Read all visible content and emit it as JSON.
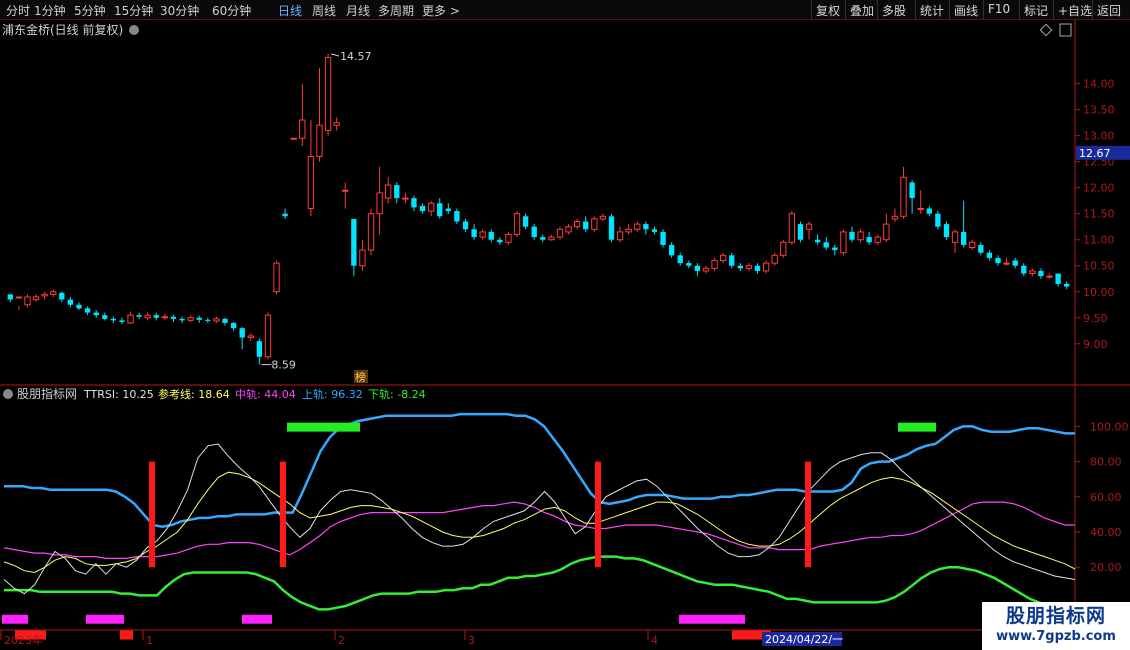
{
  "toolbar": {
    "periods": [
      {
        "label": "分时",
        "active": false
      },
      {
        "label": "1分钟",
        "active": false
      },
      {
        "label": "5分钟",
        "active": false
      },
      {
        "label": "15分钟",
        "active": false
      },
      {
        "label": "30分钟",
        "active": false
      },
      {
        "label": "60分钟",
        "active": false
      },
      {
        "label": "日线",
        "active": true
      },
      {
        "label": "周线",
        "active": false
      },
      {
        "label": "月线",
        "active": false
      },
      {
        "label": "多周期",
        "active": false
      },
      {
        "label": "更多 >",
        "active": false
      }
    ],
    "right_buttons": [
      "复权",
      "叠加",
      "多股",
      "统计",
      "画线",
      "F10",
      "标记",
      "+自选",
      "返回"
    ]
  },
  "price_panel": {
    "title": "浦东金桥(日线 前复权)",
    "high_label": "14.57",
    "low_label": "8.59",
    "current_price": "12.67",
    "tag": "榜",
    "y_labels": [
      "14.00",
      "13.50",
      "13.00",
      "12.50",
      "12.00",
      "11.50",
      "11.00",
      "10.50",
      "10.00",
      "9.50",
      "9.00"
    ]
  },
  "indicator_panel": {
    "name": "股朋指标网",
    "items": [
      {
        "label": "TTRSI: 10.25",
        "color": "#e0e0e0"
      },
      {
        "label": "参考线: 18.64",
        "color": "#ffff66"
      },
      {
        "label": "中轨: 44.04",
        "color": "#ff44ff"
      },
      {
        "label": "上轨: 96.32",
        "color": "#33aaff"
      },
      {
        "label": "下轨: -8.24",
        "color": "#33ee33"
      }
    ],
    "y_labels": [
      "100.00",
      "80.00",
      "60.00",
      "40.00",
      "20.00"
    ]
  },
  "time_axis": {
    "labels": [
      "2023年",
      "1",
      "2",
      "3",
      "4"
    ],
    "cursor_label": "2024/04/22/一"
  },
  "watermark": {
    "title": "股朋指标网",
    "url": "www.7gpzb.com"
  },
  "colors": {
    "up": "#ff3b3b",
    "down": "#00e5ff",
    "axis": "#b01818",
    "upper_band": "#33aaff",
    "middle_band": "#ff44ff",
    "lower_band": "#33ee33",
    "ttrsi": "#e0e0e0",
    "reference": "#ffff66"
  },
  "chart_data": {
    "type": "candlestick",
    "ohlc": [
      [
        9.95,
        9.85,
        9.9,
        9.8
      ],
      [
        9.88,
        9.9,
        9.72,
        9.65
      ],
      [
        9.75,
        9.9,
        9.95,
        9.7
      ],
      [
        9.85,
        9.9,
        9.95,
        9.8
      ],
      [
        9.92,
        9.95,
        10.0,
        9.85
      ],
      [
        9.95,
        10.0,
        10.05,
        9.9
      ],
      [
        9.98,
        9.85,
        10.0,
        9.8
      ],
      [
        9.85,
        9.75,
        9.9,
        9.7
      ],
      [
        9.75,
        9.68,
        9.8,
        9.65
      ],
      [
        9.68,
        9.6,
        9.72,
        9.55
      ],
      [
        9.6,
        9.55,
        9.65,
        9.5
      ],
      [
        9.55,
        9.48,
        9.6,
        9.45
      ],
      [
        9.48,
        9.45,
        9.52,
        9.4
      ],
      [
        9.45,
        9.42,
        9.5,
        9.38
      ],
      [
        9.4,
        9.55,
        9.62,
        9.38
      ],
      [
        9.55,
        9.52,
        9.6,
        9.48
      ],
      [
        9.5,
        9.55,
        9.6,
        9.45
      ],
      [
        9.55,
        9.5,
        9.6,
        9.45
      ],
      [
        9.5,
        9.52,
        9.58,
        9.46
      ],
      [
        9.52,
        9.48,
        9.56,
        9.42
      ],
      [
        9.48,
        9.45,
        9.52,
        9.4
      ],
      [
        9.45,
        9.5,
        9.55,
        9.42
      ],
      [
        9.5,
        9.46,
        9.54,
        9.4
      ],
      [
        9.46,
        9.44,
        9.5,
        9.4
      ],
      [
        9.44,
        9.48,
        9.52,
        9.4
      ],
      [
        9.48,
        9.4,
        9.5,
        9.35
      ],
      [
        9.4,
        9.3,
        9.42,
        9.25
      ],
      [
        9.3,
        9.12,
        9.32,
        8.9
      ],
      [
        9.12,
        9.15,
        9.2,
        9.05
      ],
      [
        9.05,
        8.75,
        9.1,
        8.6
      ],
      [
        8.75,
        9.55,
        9.6,
        8.7
      ],
      [
        10.0,
        10.55,
        10.6,
        9.95
      ],
      [
        11.5,
        11.45,
        11.6,
        11.4
      ],
      [
        12.95,
        12.95,
        12.95,
        12.95
      ],
      [
        12.95,
        13.3,
        14.0,
        12.8
      ],
      [
        11.6,
        12.6,
        13.3,
        11.45
      ],
      [
        12.6,
        13.2,
        14.3,
        12.5
      ],
      [
        13.1,
        14.5,
        14.57,
        13.0
      ],
      [
        13.2,
        13.25,
        13.35,
        13.1
      ],
      [
        11.95,
        11.95,
        12.1,
        11.6
      ],
      [
        11.4,
        10.5,
        11.4,
        10.3
      ],
      [
        10.5,
        10.8,
        11.0,
        10.4
      ],
      [
        10.8,
        11.5,
        11.6,
        10.7
      ],
      [
        11.5,
        11.9,
        12.4,
        11.1
      ],
      [
        11.8,
        12.05,
        12.2,
        11.7
      ],
      [
        12.05,
        11.8,
        12.1,
        11.7
      ],
      [
        11.8,
        11.8,
        11.9,
        11.7
      ],
      [
        11.8,
        11.62,
        11.85,
        11.55
      ],
      [
        11.65,
        11.55,
        11.7,
        11.5
      ],
      [
        11.55,
        11.7,
        11.75,
        11.45
      ],
      [
        11.7,
        11.45,
        11.8,
        11.4
      ],
      [
        11.6,
        11.55,
        11.7,
        11.5
      ],
      [
        11.55,
        11.35,
        11.6,
        11.3
      ],
      [
        11.35,
        11.2,
        11.4,
        11.15
      ],
      [
        11.2,
        11.05,
        11.3,
        11.0
      ],
      [
        11.05,
        11.15,
        11.2,
        11.0
      ],
      [
        11.15,
        11.0,
        11.2,
        10.95
      ],
      [
        11.0,
        10.95,
        11.05,
        10.9
      ],
      [
        10.95,
        11.1,
        11.15,
        10.9
      ],
      [
        11.1,
        11.5,
        11.55,
        11.05
      ],
      [
        11.45,
        11.25,
        11.5,
        11.2
      ],
      [
        11.25,
        11.05,
        11.3,
        11.0
      ],
      [
        11.05,
        11.0,
        11.1,
        10.95
      ],
      [
        11.0,
        11.05,
        11.1,
        10.98
      ],
      [
        11.05,
        11.2,
        11.25,
        11.0
      ],
      [
        11.15,
        11.25,
        11.3,
        11.1
      ],
      [
        11.25,
        11.35,
        11.4,
        11.2
      ],
      [
        11.35,
        11.2,
        11.45,
        11.15
      ],
      [
        11.2,
        11.4,
        11.45,
        11.15
      ],
      [
        11.4,
        11.45,
        11.5,
        11.35
      ],
      [
        11.45,
        11.0,
        11.5,
        10.95
      ],
      [
        11.0,
        11.15,
        11.25,
        10.95
      ],
      [
        11.15,
        11.2,
        11.3,
        11.1
      ],
      [
        11.2,
        11.3,
        11.35,
        11.15
      ],
      [
        11.3,
        11.2,
        11.35,
        11.1
      ],
      [
        11.2,
        11.15,
        11.25,
        11.1
      ],
      [
        11.15,
        10.9,
        11.2,
        10.85
      ],
      [
        10.9,
        10.7,
        10.95,
        10.65
      ],
      [
        10.7,
        10.55,
        10.75,
        10.5
      ],
      [
        10.55,
        10.5,
        10.6,
        10.45
      ],
      [
        10.5,
        10.4,
        10.55,
        10.3
      ],
      [
        10.4,
        10.45,
        10.5,
        10.35
      ],
      [
        10.45,
        10.6,
        10.65,
        10.4
      ],
      [
        10.6,
        10.7,
        10.75,
        10.55
      ],
      [
        10.7,
        10.5,
        10.75,
        10.45
      ],
      [
        10.5,
        10.45,
        10.55,
        10.4
      ],
      [
        10.45,
        10.5,
        10.55,
        10.4
      ],
      [
        10.5,
        10.4,
        10.55,
        10.35
      ],
      [
        10.4,
        10.55,
        10.6,
        10.35
      ],
      [
        10.55,
        10.7,
        10.75,
        10.5
      ],
      [
        10.7,
        10.95,
        11.0,
        10.65
      ],
      [
        10.95,
        11.5,
        11.55,
        10.9
      ],
      [
        11.3,
        11.0,
        11.35,
        10.95
      ],
      [
        11.2,
        11.3,
        11.35,
        11.0
      ],
      [
        11.0,
        10.95,
        11.1,
        10.9
      ],
      [
        10.95,
        10.85,
        11.05,
        10.8
      ],
      [
        10.85,
        10.8,
        10.9,
        10.7
      ],
      [
        10.75,
        11.15,
        11.2,
        10.7
      ],
      [
        11.15,
        11.0,
        11.25,
        10.95
      ],
      [
        11.0,
        11.15,
        11.2,
        10.95
      ],
      [
        11.05,
        10.95,
        11.15,
        10.9
      ],
      [
        10.95,
        11.05,
        11.1,
        10.9
      ],
      [
        11.0,
        11.3,
        11.5,
        10.95
      ],
      [
        11.4,
        11.45,
        11.6,
        11.35
      ],
      [
        11.45,
        12.2,
        12.4,
        11.4
      ],
      [
        12.1,
        11.8,
        12.15,
        11.5
      ],
      [
        11.6,
        11.6,
        11.95,
        11.5
      ],
      [
        11.6,
        11.5,
        11.65,
        11.45
      ],
      [
        11.5,
        11.25,
        11.55,
        11.2
      ],
      [
        11.3,
        11.05,
        11.35,
        11.0
      ],
      [
        10.95,
        11.15,
        11.2,
        10.75
      ],
      [
        11.15,
        10.9,
        11.75,
        10.85
      ],
      [
        10.85,
        10.95,
        11.0,
        10.8
      ],
      [
        10.9,
        10.75,
        10.95,
        10.7
      ],
      [
        10.75,
        10.65,
        10.8,
        10.6
      ],
      [
        10.65,
        10.55,
        10.7,
        10.5
      ],
      [
        10.55,
        10.55,
        10.65,
        10.5
      ],
      [
        10.6,
        10.5,
        10.65,
        10.45
      ],
      [
        10.5,
        10.35,
        10.55,
        10.3
      ],
      [
        10.35,
        10.4,
        10.45,
        10.3
      ],
      [
        10.4,
        10.3,
        10.45,
        10.25
      ],
      [
        10.3,
        10.3,
        10.35,
        10.25
      ],
      [
        10.35,
        10.15,
        10.35,
        10.1
      ],
      [
        10.15,
        10.1,
        10.2,
        10.05
      ]
    ],
    "ylim": [
      8.4,
      14.8
    ],
    "indicator": {
      "upper": [
        66,
        66,
        66,
        65,
        65,
        64,
        64,
        64,
        64,
        64,
        64,
        64,
        63,
        60,
        56,
        50,
        44,
        43,
        44,
        46,
        47,
        48,
        48,
        49,
        49,
        50,
        50,
        50,
        50,
        51,
        51,
        51,
        62,
        74,
        86,
        94,
        99,
        101,
        103,
        104,
        105,
        106,
        106,
        106,
        106,
        106,
        106,
        106,
        106,
        107,
        107,
        107,
        107,
        107,
        107,
        106,
        106,
        104,
        100,
        93,
        86,
        78,
        70,
        62,
        57,
        56,
        57,
        58,
        60,
        61,
        61,
        61,
        60,
        59,
        59,
        59,
        59,
        60,
        60,
        61,
        61,
        62,
        63,
        64,
        64,
        64,
        63,
        63,
        63,
        63,
        64,
        68,
        76,
        79,
        80,
        80,
        82,
        84,
        87,
        89,
        90,
        94,
        98,
        100,
        100,
        98,
        97,
        97,
        97,
        98,
        99,
        99,
        98,
        97,
        96,
        96
      ],
      "middle": [
        31,
        30,
        29,
        28,
        28,
        27,
        27,
        26,
        26,
        26,
        25,
        25,
        25,
        26,
        26,
        26,
        27,
        28,
        30,
        32,
        33,
        33,
        34,
        34,
        34,
        33,
        31,
        29,
        27,
        30,
        34,
        38,
        43,
        46,
        48,
        50,
        51,
        51,
        51,
        51,
        51,
        51,
        51,
        51,
        52,
        53,
        54,
        55,
        55,
        56,
        57,
        56,
        54,
        51,
        49,
        46,
        44,
        43,
        42,
        42,
        43,
        44,
        44,
        44,
        44,
        43,
        42,
        41,
        40,
        39,
        37,
        35,
        33,
        31,
        31,
        31,
        30,
        30,
        30,
        30,
        32,
        33,
        34,
        35,
        36,
        37,
        37,
        38,
        38,
        39,
        41,
        44,
        47,
        50,
        53,
        56,
        57,
        57,
        57,
        56,
        54,
        51,
        48,
        46,
        44,
        44
      ],
      "ttrsi": [
        13,
        8,
        5,
        10,
        20,
        29,
        25,
        18,
        16,
        22,
        16,
        22,
        20,
        24,
        31,
        35,
        42,
        52,
        64,
        82,
        89,
        90,
        83,
        77,
        72,
        66,
        58,
        50,
        43,
        37,
        42,
        52,
        58,
        63,
        64,
        63,
        62,
        58,
        53,
        48,
        42,
        37,
        34,
        32,
        32,
        33,
        37,
        42,
        46,
        48,
        50,
        52,
        57,
        63,
        57,
        48,
        39,
        43,
        52,
        60,
        63,
        66,
        69,
        70,
        66,
        60,
        54,
        48,
        42,
        37,
        32,
        28,
        26,
        26,
        27,
        31,
        37,
        46,
        55,
        64,
        70,
        76,
        80,
        82,
        84,
        85,
        85,
        81,
        75,
        70,
        65,
        60,
        55,
        50,
        45,
        40,
        35,
        30,
        26,
        23,
        21,
        19,
        17,
        15,
        14,
        13
      ],
      "reference": [
        23,
        21,
        18,
        17,
        20,
        24,
        26,
        25,
        22,
        21,
        21,
        22,
        23,
        25,
        29,
        32,
        36,
        40,
        47,
        56,
        64,
        71,
        74,
        73,
        71,
        68,
        64,
        60,
        56,
        51,
        48,
        49,
        50,
        52,
        54,
        55,
        55,
        54,
        53,
        51,
        49,
        46,
        43,
        40,
        38,
        37,
        37,
        38,
        40,
        42,
        45,
        47,
        50,
        53,
        54,
        52,
        48,
        45,
        45,
        47,
        49,
        51,
        53,
        55,
        57,
        57,
        56,
        53,
        50,
        46,
        42,
        38,
        35,
        33,
        32,
        32,
        33,
        36,
        40,
        45,
        50,
        55,
        59,
        62,
        65,
        68,
        70,
        71,
        70,
        68,
        65,
        62,
        58,
        54,
        50,
        46,
        42,
        38,
        35,
        32,
        30,
        28,
        26,
        24,
        22,
        19
      ],
      "lower": [
        7,
        7,
        7,
        7,
        6,
        6,
        6,
        6,
        6,
        6,
        6,
        6,
        6,
        5,
        5,
        4,
        4,
        4,
        9,
        13,
        16,
        17,
        17,
        17,
        17,
        17,
        17,
        17,
        16,
        14,
        12,
        7,
        3,
        0,
        -2,
        -4,
        -4,
        -3,
        -2,
        0,
        2,
        4,
        5,
        5,
        5,
        5,
        6,
        6,
        6,
        7,
        7,
        8,
        8,
        10,
        10,
        12,
        14,
        14,
        15,
        15,
        16,
        17,
        19,
        22,
        24,
        25,
        26,
        26,
        26,
        25,
        25,
        24,
        22,
        20,
        18,
        16,
        14,
        12,
        11,
        10,
        10,
        10,
        9,
        8,
        7,
        6,
        4,
        2,
        2,
        1,
        0,
        0,
        0,
        0,
        0,
        0,
        0,
        0,
        1,
        3,
        6,
        10,
        14,
        17,
        19,
        20,
        20,
        19,
        18,
        16,
        14,
        11,
        8,
        5,
        2,
        0,
        -2,
        -4,
        -6,
        -8
      ]
    }
  }
}
